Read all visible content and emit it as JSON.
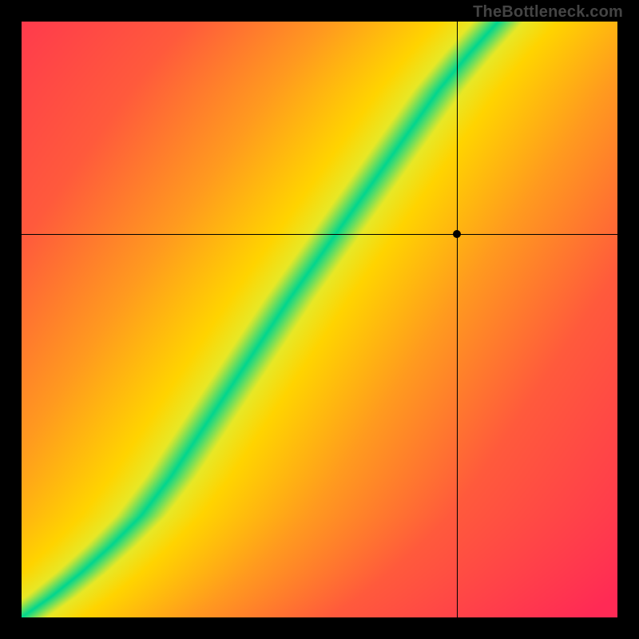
{
  "attribution": "TheBottleneck.com",
  "colors": {
    "background": "#000000",
    "low": "#ff2a55",
    "mid": "#ffd400",
    "optimal": "#00d68f"
  },
  "chart_data": {
    "type": "heatmap",
    "title": "",
    "xlabel": "",
    "ylabel": "",
    "xlim": [
      0,
      1
    ],
    "ylim": [
      0,
      1
    ],
    "grid": false,
    "legend": false,
    "description": "Compatibility heatmap. Green curve shows the optimal pairing; color fades to yellow then red with increasing mismatch in either direction.",
    "optimal_curve": {
      "note": "y as monotone function of x, normalized 0..1; piecewise samples along the green centerline",
      "x": [
        0.0,
        0.05,
        0.1,
        0.15,
        0.2,
        0.25,
        0.3,
        0.35,
        0.4,
        0.45,
        0.5,
        0.55,
        0.6,
        0.65,
        0.7,
        0.75,
        0.8
      ],
      "y": [
        0.0,
        0.035,
        0.075,
        0.12,
        0.17,
        0.235,
        0.31,
        0.385,
        0.46,
        0.535,
        0.605,
        0.675,
        0.745,
        0.815,
        0.885,
        0.945,
        1.0
      ]
    },
    "optimal_band_halfwidth_x": 0.033,
    "crosshair": {
      "x": 0.73,
      "y": 0.643
    },
    "marker": {
      "x": 0.73,
      "y": 0.643
    },
    "color_stops": {
      "relative_distance_from_centerline_x": true,
      "stops": [
        {
          "d": 0.0,
          "color": "#00d68f"
        },
        {
          "d": 0.05,
          "color": "#e8e826"
        },
        {
          "d": 0.11,
          "color": "#ffd400"
        },
        {
          "d": 0.3,
          "color": "#ff9a1f"
        },
        {
          "d": 0.55,
          "color": "#ff5a3c"
        },
        {
          "d": 1.0,
          "color": "#ff2a55"
        }
      ]
    }
  }
}
